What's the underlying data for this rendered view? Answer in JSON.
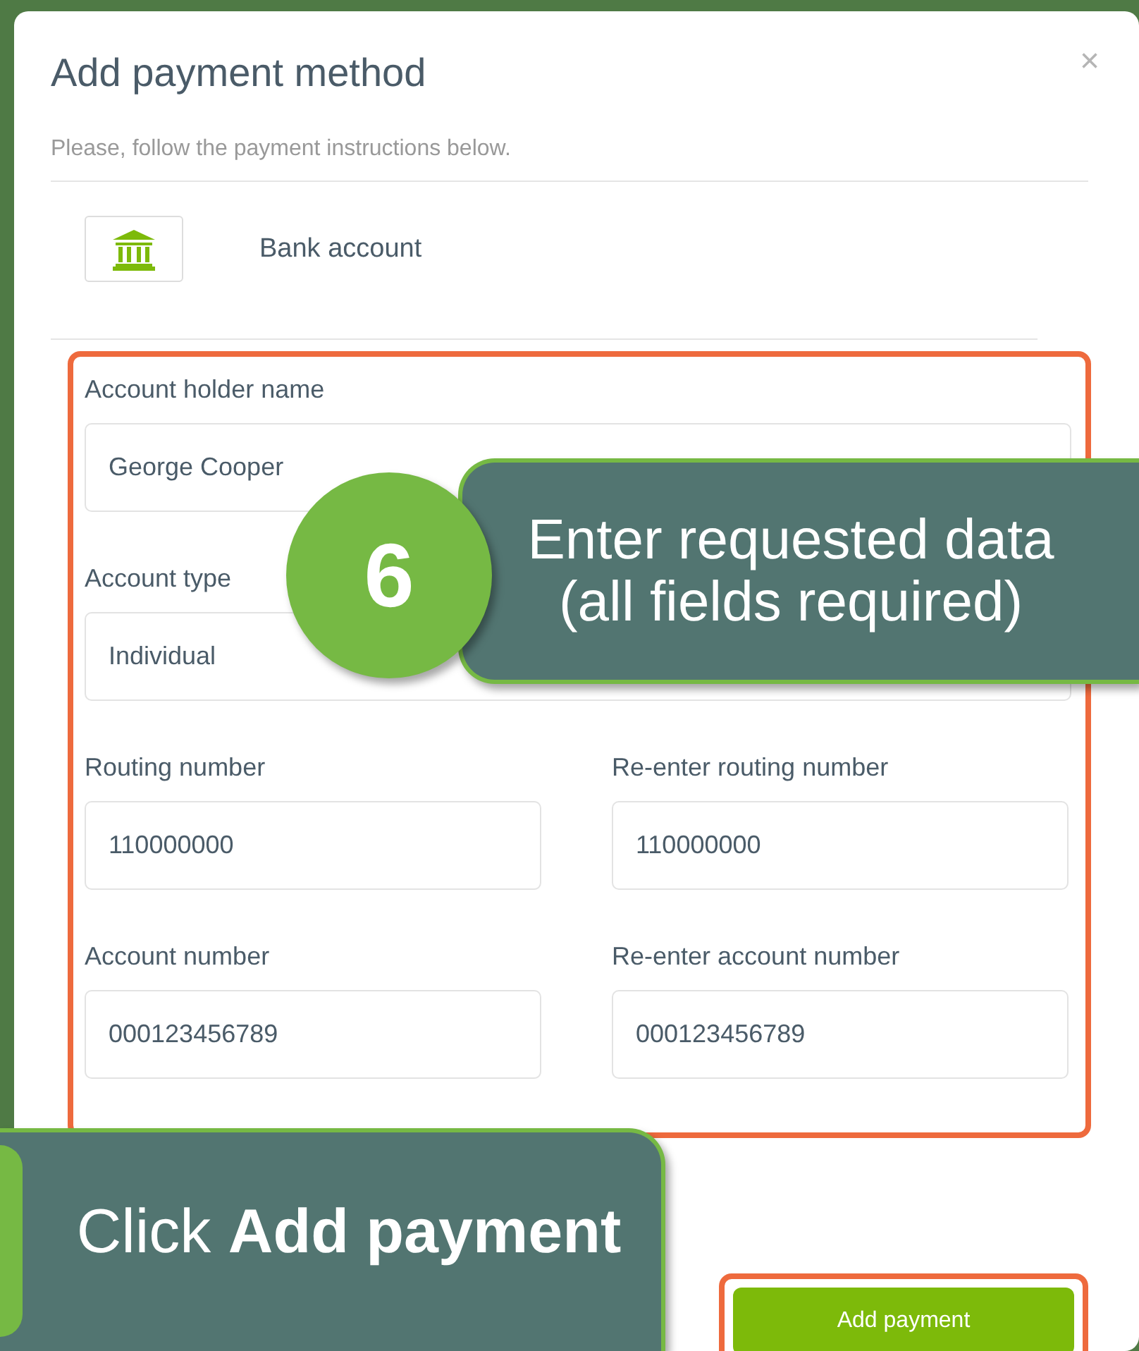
{
  "dialog": {
    "title": "Add payment method",
    "close": "×",
    "instructions": "Please, follow the payment instructions below.",
    "method": {
      "label": "Bank account"
    },
    "fields": [
      {
        "label": "Account holder name",
        "value": "George Cooper",
        "kind": "full"
      },
      {
        "label": "Account type",
        "value": "Individual",
        "kind": "full"
      },
      {
        "label": "Routing number",
        "value": "110000000",
        "kind": "half"
      },
      {
        "label": "Re-enter routing number",
        "value": "110000000",
        "kind": "half"
      },
      {
        "label": "Account number",
        "value": "000123456789",
        "kind": "half"
      },
      {
        "label": "Re-enter account number",
        "value": "000123456789",
        "kind": "half"
      }
    ],
    "submit": "Add payment"
  },
  "callouts": [
    {
      "step": "6",
      "lines": [
        "Enter requested data",
        "(all fields required)"
      ]
    },
    {
      "lines": [
        "Click **Add payment**"
      ]
    }
  ]
}
